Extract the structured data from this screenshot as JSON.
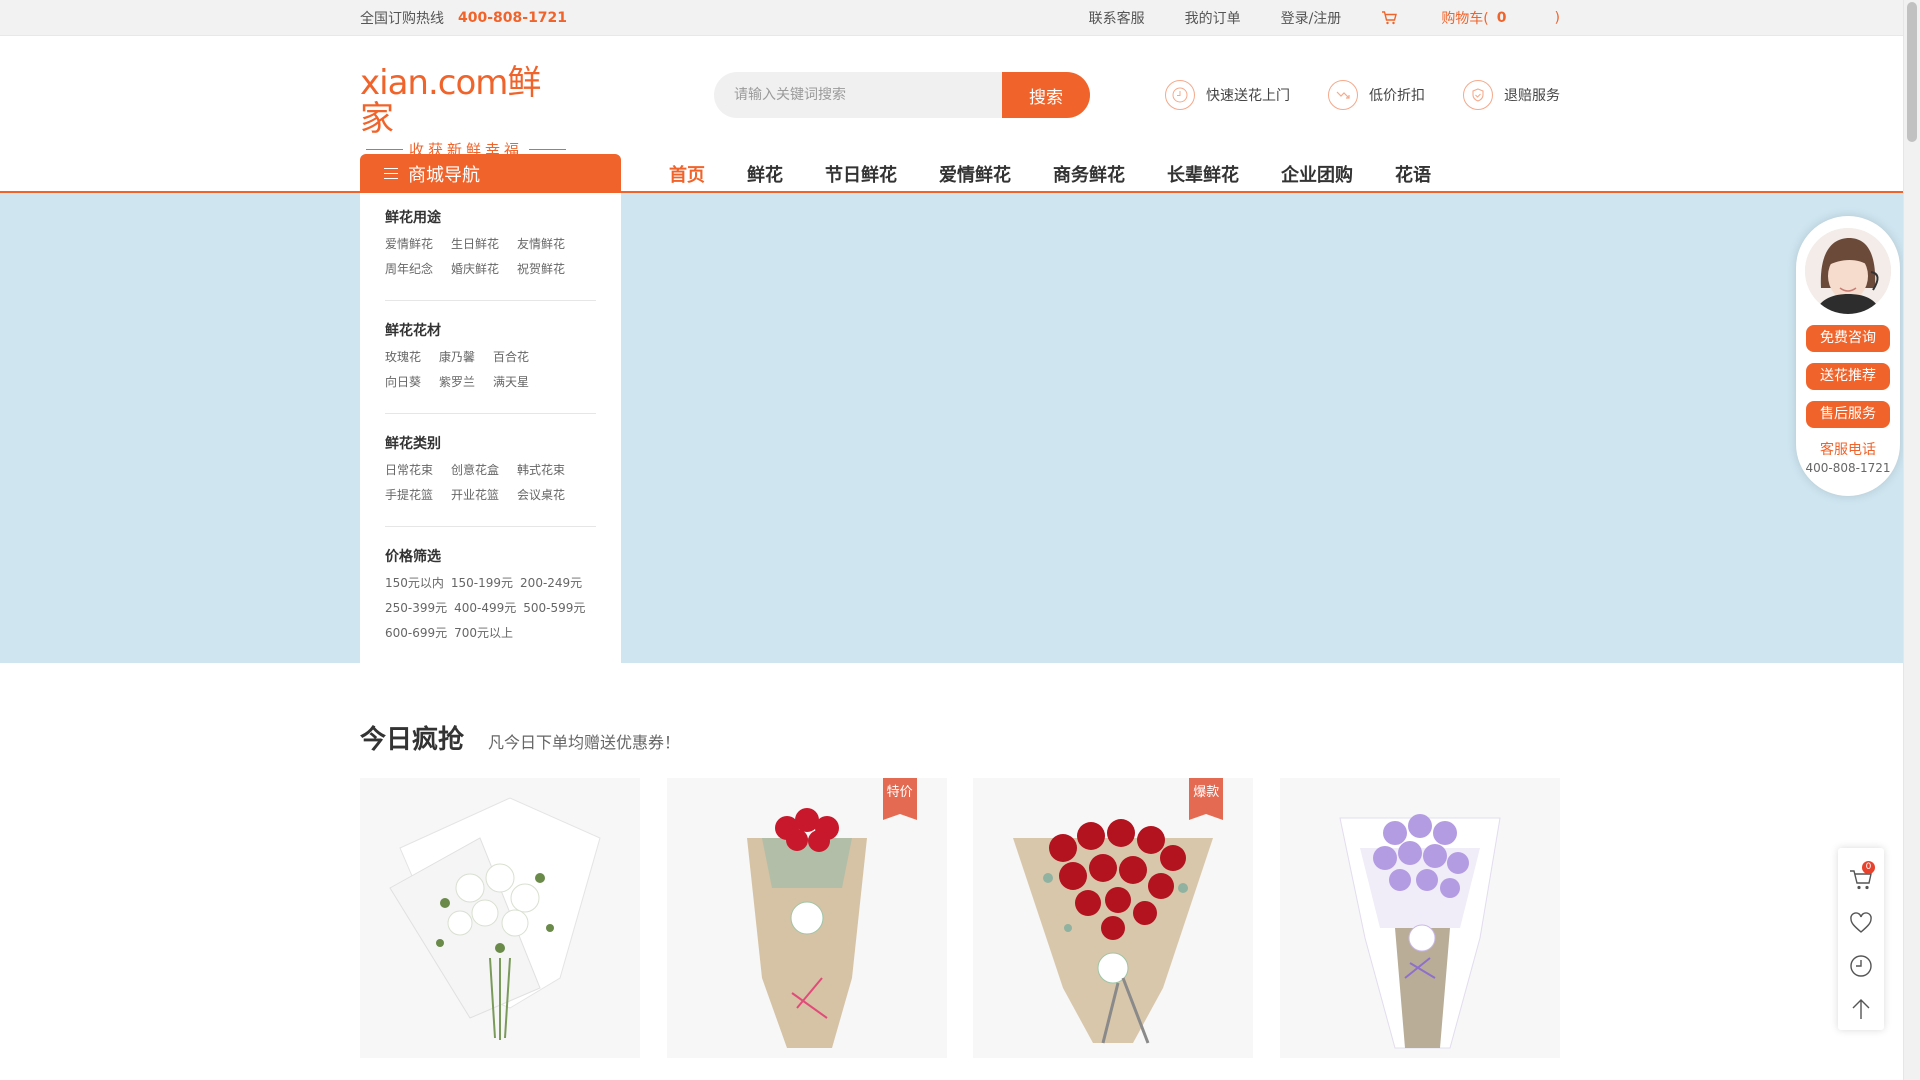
{
  "topbar": {
    "hotline_label": "全国订购热线",
    "hotline_number": "400-808-1721",
    "links": [
      "联系客服",
      "我的订单",
      "登录/注册"
    ],
    "cart_label": "购物车(",
    "cart_count": "0",
    "cart_close": ")"
  },
  "header": {
    "logo_main": "xian.com鲜家",
    "logo_sub": "收获新鲜幸福",
    "search_placeholder": "请输入关键词搜索",
    "search_button": "搜索",
    "features": [
      "快速送花上门",
      "低价折扣",
      "退赔服务"
    ]
  },
  "nav": {
    "category_button": "商城导航",
    "links": [
      "首页",
      "鲜花",
      "节日鲜花",
      "爱情鲜花",
      "商务鲜花",
      "长辈鲜花",
      "企业团购",
      "花语"
    ],
    "active": "首页"
  },
  "catmenu": {
    "groups": [
      {
        "title": "鲜花用途",
        "items": [
          "爱情鲜花",
          "生日鲜花",
          "友情鲜花",
          "周年纪念",
          "婚庆鲜花",
          "祝贺鲜花"
        ]
      },
      {
        "title": "鲜花花材",
        "items": [
          "玫瑰花",
          "康乃馨",
          "百合花",
          "向日葵",
          "紫罗兰",
          "满天星"
        ]
      },
      {
        "title": "鲜花类别",
        "items": [
          "日常花束",
          "创意花盒",
          "韩式花束",
          "手提花篮",
          "开业花篮",
          "会议桌花"
        ]
      },
      {
        "title": "价格筛选",
        "items": [
          "150元以内",
          "150-199元",
          "200-249元",
          "250-399元",
          "400-499元",
          "500-599元",
          "600-699元",
          "700元以上"
        ]
      }
    ]
  },
  "section": {
    "title": "今日疯抢",
    "subtitle": "凡今日下单均赠送优惠券！",
    "products": [
      {
        "tag": "",
        "flower": "white",
        "wrap": "white"
      },
      {
        "tag": "特价",
        "flower": "red",
        "wrap": "kraft"
      },
      {
        "tag": "爆款",
        "flower": "red",
        "wrap": "kraft"
      },
      {
        "tag": "",
        "flower": "purple",
        "wrap": "white"
      }
    ]
  },
  "service": {
    "buttons": [
      "免费咨询",
      "送花推荐",
      "售后服务"
    ],
    "phone_label": "客服电话",
    "phone": "400-808-1721"
  },
  "toolbar": {
    "cart_badge": "0"
  },
  "colors": {
    "accent": "#f0642b",
    "banner": "#cfe6f1"
  }
}
